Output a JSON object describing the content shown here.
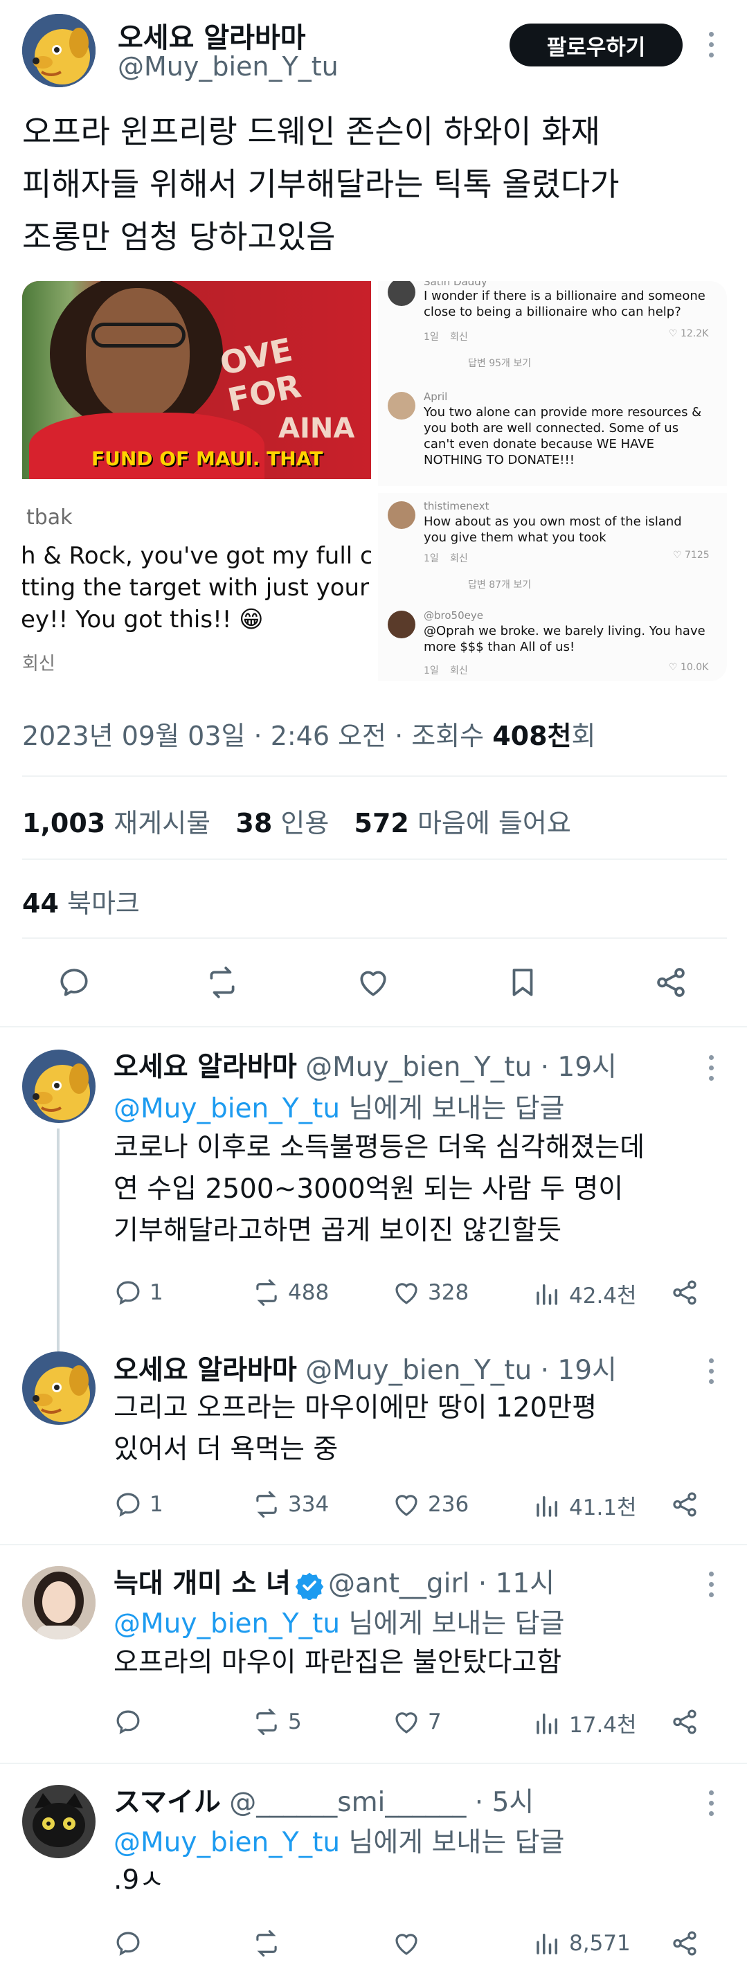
{
  "main_tweet": {
    "author_name": "오세요 알라바마",
    "author_handle": "@Muy_bien_Y_tu",
    "follow_label": "팔로우하기",
    "text_lines": [
      "오프라 윈프리랑 드웨인 존슨이 하와이 화재",
      "피해자들 위해서 기부해달라는 틱톡 올렸다가",
      "조롱만 엄청 당하고있음"
    ],
    "media": {
      "caption": "FUND OF MAUI. THAT",
      "shirt_text_1": "OVE FOR",
      "shirt_text_2": "AINA",
      "left_comment": {
        "user": "tbak",
        "lines": [
          "h & Rock, you've got my full co",
          "tting the target with just your o",
          "ey!! You got this!! 😁"
        ],
        "reply": "회신"
      },
      "comments": [
        {
          "user": "Satin Daddy",
          "text": [
            "I wonder if there is a billionaire and someone",
            "close to being a billionaire who can help?"
          ],
          "time": "1일",
          "reply": "회신",
          "likes": "12.2K",
          "thread": "답변 95개 보기"
        },
        {
          "user": "April",
          "text": [
            "You two alone can provide more resources &",
            "you both are well connected. Some of us",
            "can't even donate because WE HAVE",
            "NOTHING TO DONATE!!!"
          ],
          "time": "",
          "reply": "",
          "likes": "",
          "thread": ""
        },
        {
          "user": "thistimenext",
          "text": [
            "How about as you own most of the island",
            "you give them what you took"
          ],
          "time": "1일",
          "reply": "회신",
          "likes": "7125",
          "thread": "답변 87개 보기"
        },
        {
          "user": "@bro50eye",
          "text": [
            "@Oprah we broke. we barely living. You have",
            "more $$$ than All of us!"
          ],
          "time": "1일",
          "reply": "회신",
          "likes": "10.0K",
          "thread": ""
        }
      ]
    },
    "date": "2023년 09월 03일 · 2:46 오전 · 조회수 ",
    "views": "408천",
    "views_suffix": "회",
    "retweets_count": "1,003",
    "retweets_label": "재게시물",
    "quotes_count": "38",
    "quotes_label": "인용",
    "likes_count": "572",
    "likes_label": "마음에 들어요",
    "bookmarks_count": "44",
    "bookmarks_label": "북마크"
  },
  "replies": [
    {
      "author_name": "오세요 알라바마",
      "author_handle": "@Muy_bien_Y_tu · 19시",
      "reply_to": "@Muy_bien_Y_tu",
      "reply_to_suffix": "님에게 보내는 답글",
      "lines": [
        "코로나 이후로 소득불평등은 더욱 심각해졌는데",
        "연 수입 2500~3000억원 되는 사람 두 명이",
        "기부해달라고하면 곱게 보이진 않긴할듯"
      ],
      "replies": "1",
      "retweets": "488",
      "likes": "328",
      "views": "42.4천"
    },
    {
      "author_name": "오세요 알라바마",
      "author_handle": "@Muy_bien_Y_tu · 19시",
      "reply_to": "",
      "reply_to_suffix": "",
      "lines": [
        "그리고 오프라는 마우이에만 땅이 120만평",
        "있어서 더 욕먹는 중"
      ],
      "replies": "1",
      "retweets": "334",
      "likes": "236",
      "views": "41.1천"
    },
    {
      "author_name": "늑대 개미 소 녀",
      "author_handle": "@ant__girl · 11시",
      "reply_to": "@Muy_bien_Y_tu",
      "reply_to_suffix": "님에게 보내는 답글",
      "lines": [
        "오프라의 마우이 파란집은 불안탔다고함"
      ],
      "replies": "",
      "retweets": "5",
      "likes": "7",
      "views": "17.4천"
    },
    {
      "author_name": "スマイル",
      "author_handle": "@______smi______ · 5시",
      "reply_to": "@Muy_bien_Y_tu",
      "reply_to_suffix": "님에게 보내는 답글",
      "lines": [
        ".9ㅅ"
      ],
      "replies": "",
      "retweets": "",
      "likes": "",
      "views": "8,571"
    }
  ],
  "colors": {
    "accent": "#1d9bf0",
    "text": "#0f1419",
    "muted": "#536471",
    "divider": "#eff3f4"
  }
}
